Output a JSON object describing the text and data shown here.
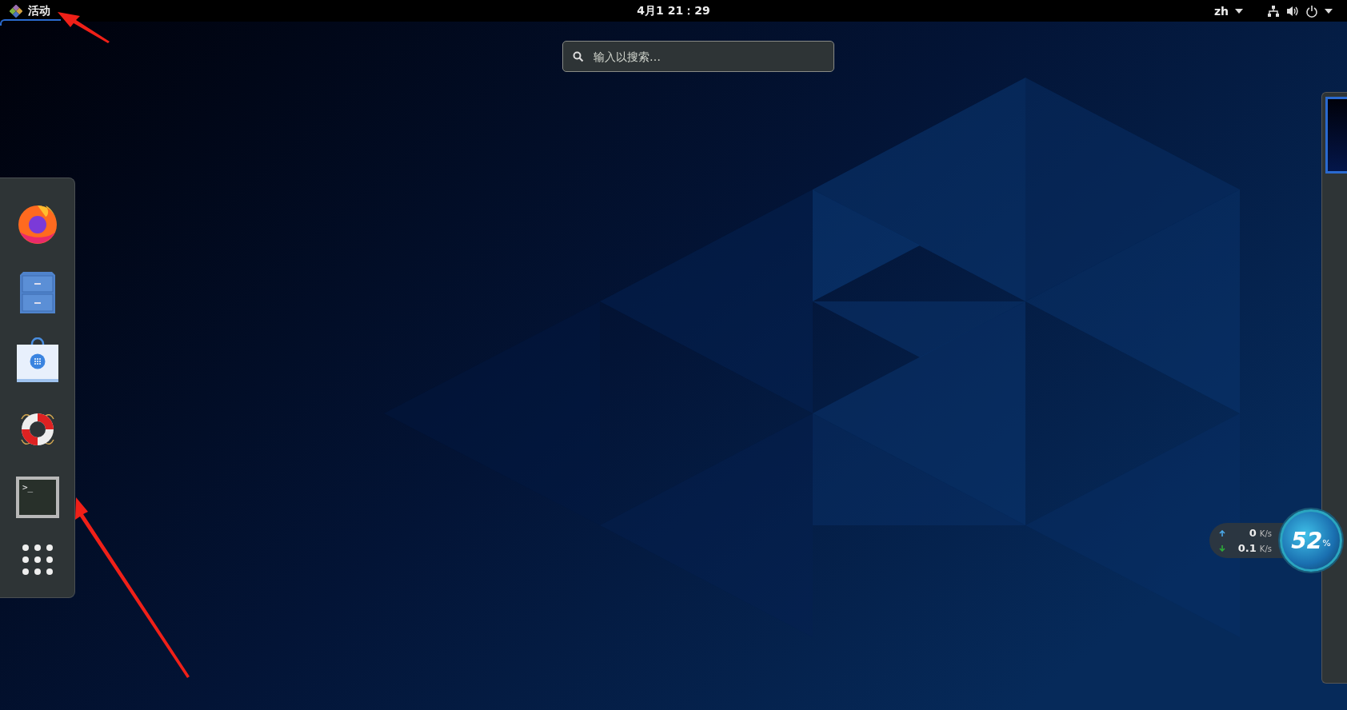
{
  "top_bar": {
    "activities_label": "活动",
    "clock": "4月1 21：29",
    "language": "zh"
  },
  "search": {
    "placeholder": "输入以搜索…"
  },
  "dock": {
    "apps": [
      {
        "kind": "browser"
      },
      {
        "kind": "files"
      },
      {
        "kind": "software"
      },
      {
        "kind": "help"
      },
      {
        "kind": "terminal",
        "prompt": ">_"
      },
      {
        "kind": "app-grid"
      }
    ]
  },
  "net_monitor": {
    "upload": {
      "value": "0",
      "unit": "K/s"
    },
    "download": {
      "value": "0.1",
      "unit": "K/s"
    },
    "gauge_value": "52",
    "gauge_unit": "%"
  }
}
